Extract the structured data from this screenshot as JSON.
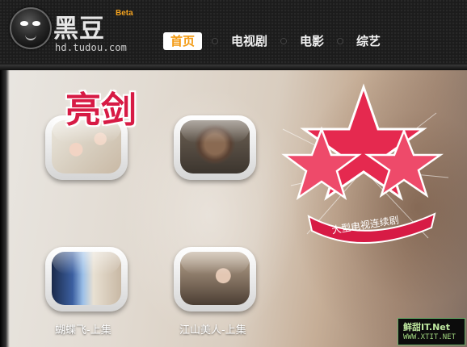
{
  "header": {
    "logo_text": "黑豆",
    "beta_label": "Beta",
    "domain": "hd.tudou.com"
  },
  "nav": {
    "items": [
      {
        "label": "首页",
        "active": true
      },
      {
        "label": "电视剧",
        "active": false
      },
      {
        "label": "电影",
        "active": false
      },
      {
        "label": "综艺",
        "active": false
      }
    ]
  },
  "content": {
    "promo": {
      "title": "亮剑",
      "subtitle": "大型电视连续剧"
    },
    "thumbnails": [
      {
        "caption": ""
      },
      {
        "caption": ""
      },
      {
        "caption": "蝴蝶飞-上集"
      },
      {
        "caption": "江山美人-上集"
      }
    ]
  },
  "watermark": {
    "top": "鲜甜IT.Net",
    "bottom": "WWW.XTIT.NET"
  },
  "colors": {
    "accent_orange": "#f39a12",
    "promo_red": "#d71b45"
  }
}
